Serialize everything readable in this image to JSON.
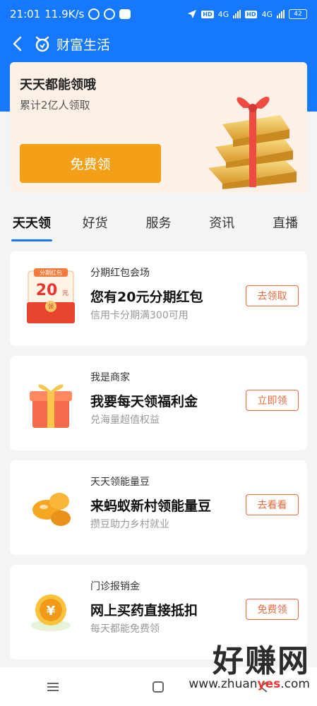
{
  "status_bar": {
    "time": "21:01",
    "speed": "11.9K/s",
    "network_a": "4G",
    "network_b": "4G",
    "hd_a": "HD",
    "hd_b": "HD",
    "battery": "42"
  },
  "nav": {
    "title": "财富生活",
    "back_icon": "chevron-left-icon",
    "brand_icon": "alipay-wealth-icon"
  },
  "banner": {
    "title": "天天都能领哦",
    "subtitle": "累计2亿人领取",
    "button_label": "免费领"
  },
  "tabs": [
    {
      "label": "天天领",
      "active": true
    },
    {
      "label": "好货",
      "active": false
    },
    {
      "label": "服务",
      "active": false
    },
    {
      "label": "资讯",
      "active": false
    },
    {
      "label": "直播",
      "active": false
    }
  ],
  "cards": [
    {
      "category": "分期红包会场",
      "title": "您有20元分期红包",
      "desc": "信用卡分期满300可用",
      "action": "去领取",
      "thumb_label": "分期红包",
      "thumb_amount": "20",
      "thumb_unit": "元",
      "thumb_badge": "领"
    },
    {
      "category": "我是商家",
      "title": "我要每天领福利金",
      "desc": "兑海量超值权益",
      "action": "立即领"
    },
    {
      "category": "天天领能量豆",
      "title": "来蚂蚁新村领能量豆",
      "desc": "攒豆助力乡村就业",
      "action": "去看看"
    },
    {
      "category": "门诊报销金",
      "title": "网上买药直接抵扣",
      "desc": "每天都能免费领",
      "action": "免费领",
      "thumb_symbol": "¥"
    }
  ],
  "watermark": {
    "main": "好赚网",
    "url_prefix": "www.zhuan",
    "url_highlight": "yes",
    "url_suffix": ".com"
  },
  "colors": {
    "brand_blue": "#1677ff",
    "banner_button": "#f3a016",
    "action_orange": "#ea6a3e"
  }
}
